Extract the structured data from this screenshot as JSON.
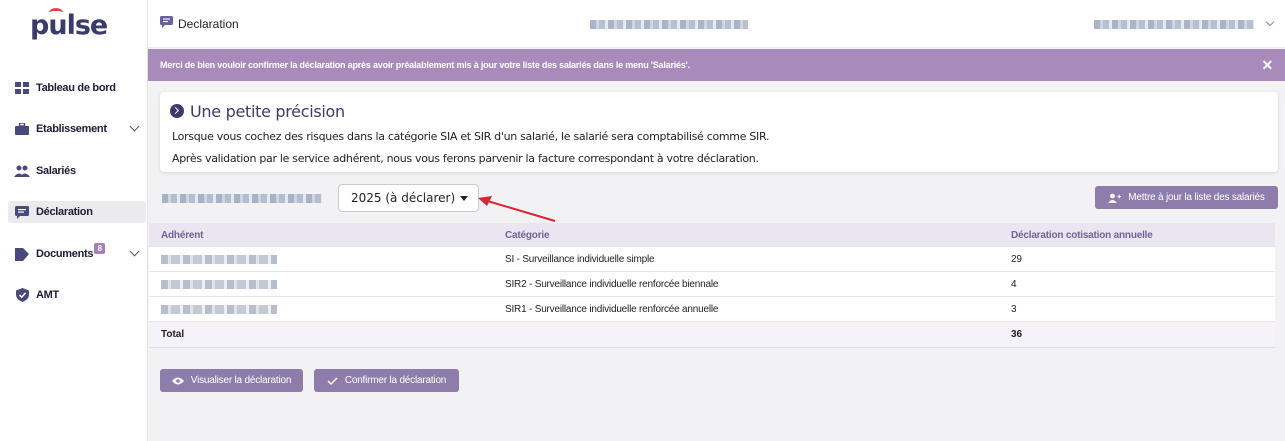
{
  "app": {
    "logo": "pulse"
  },
  "sidebar": {
    "items": [
      {
        "label": "Tableau de bord",
        "icon": "dashboard-icon"
      },
      {
        "label": "Etablissement",
        "icon": "briefcase-icon"
      },
      {
        "label": "Salariés",
        "icon": "users-icon"
      },
      {
        "label": "Déclaration",
        "icon": "message-icon"
      },
      {
        "label": "Documents",
        "icon": "document-icon",
        "badge": "8"
      },
      {
        "label": "AMT",
        "icon": "shield-icon"
      }
    ]
  },
  "header": {
    "title": "Declaration"
  },
  "banner": {
    "text": "Merci de bien vouloir confirmer la déclaration après avoir préalablement mis à jour votre liste des salariés dans le menu 'Salariés'.",
    "close": "✕"
  },
  "info": {
    "title": "Une petite précision",
    "line1": "Lorsque vous cochez des risques dans la catégorie SIA et SIR d'un salarié, le salarié sera comptabilisé comme SIR.",
    "line2": "Après validation par le service adhérent, nous vous ferons parvenir la facture correspondant à votre déclaration."
  },
  "year_select": {
    "value": "2025 (à déclarer)"
  },
  "update_button": {
    "label": "Mettre à jour la liste des salariés"
  },
  "table": {
    "headers": [
      "Adhérent",
      "Catégorie",
      "Déclaration cotisation annuelle"
    ],
    "rows": [
      {
        "categorie": "SI - Surveillance individuelle simple",
        "value": "29"
      },
      {
        "categorie": "SIR2 - Surveillance individuelle renforcée biennale",
        "value": "4"
      },
      {
        "categorie": "SIR1 - Surveillance individuelle renforcée annuelle",
        "value": "3"
      }
    ],
    "total_label": "Total",
    "total_value": "36"
  },
  "actions": {
    "view_label": "Visualiser la déclaration",
    "confirm_label": "Confirmer la déclaration"
  },
  "colors": {
    "accent": "#8e7dab",
    "banner": "#a98bbb",
    "annotation_arrow": "#d9262f"
  }
}
